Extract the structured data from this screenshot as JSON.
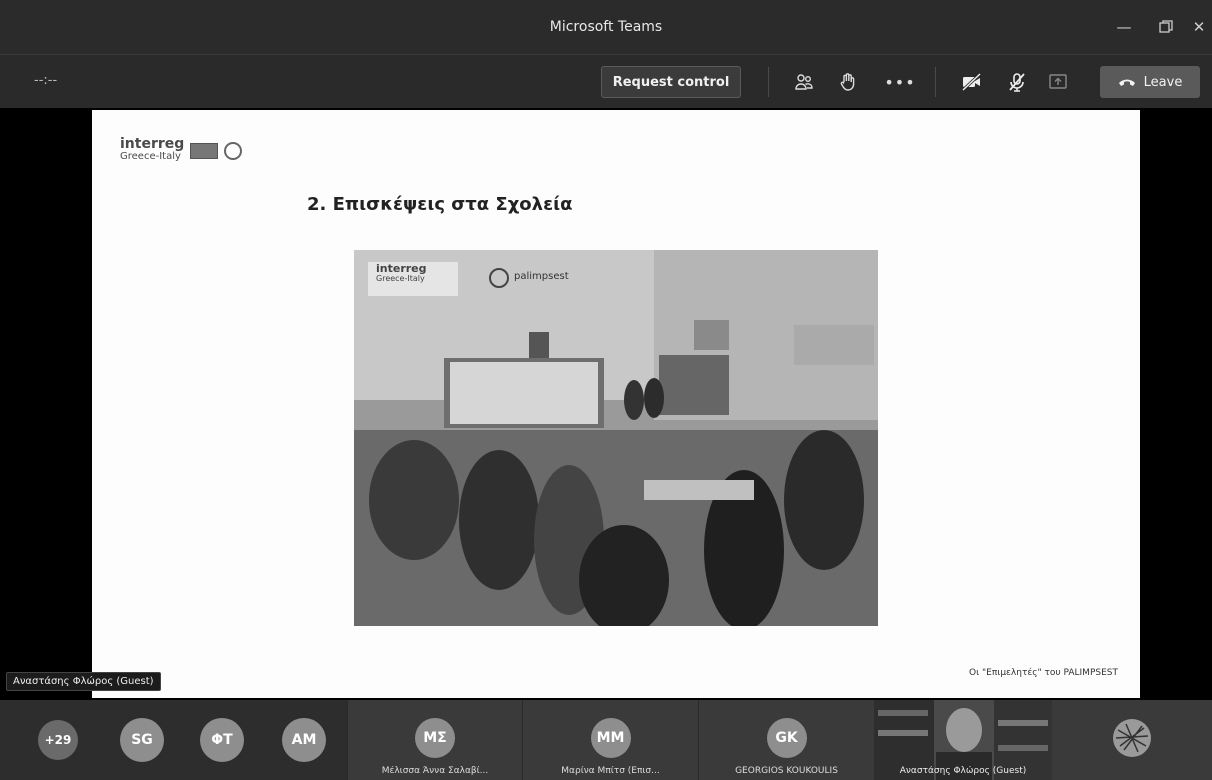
{
  "window": {
    "title": "Microsoft Teams"
  },
  "toolbar": {
    "timer": "--:--",
    "request_control_label": "Request control",
    "leave_label": "Leave"
  },
  "slide": {
    "logo_line1": "interreg",
    "logo_line2": "Greece-Italy",
    "title": "2. Επισκέψεις στα Σχολεία",
    "photo_logo_line1": "interreg",
    "photo_logo_line2": "Greece-Italy",
    "photo_brand": "palimpsest",
    "caption": "Οι \"Επιμελητές\" του PALIMPSEST"
  },
  "presenter": {
    "name": "Αναστάσης Φλώρος (Guest)"
  },
  "participants": {
    "overflow": "+29",
    "avatars": [
      "SG",
      "ΦΤ",
      "AM"
    ],
    "tiles": [
      {
        "initials": "ΜΣ",
        "name": "Μέλισσα Άννα Σαλαβί..."
      },
      {
        "initials": "ΜΜ",
        "name": "Μαρίνα Μπίτσ (Επισ..."
      },
      {
        "initials": "GK",
        "name": "GEORGIOS KOUKOULIS"
      }
    ],
    "video_name": "Αναστάσης Φλώρος (Guest)"
  },
  "colors": {
    "titlebar": "#2b2b2b",
    "toolbar": "#2a2a2a",
    "strip": "#2d2d2d",
    "avatar": "#8e8e8e"
  }
}
